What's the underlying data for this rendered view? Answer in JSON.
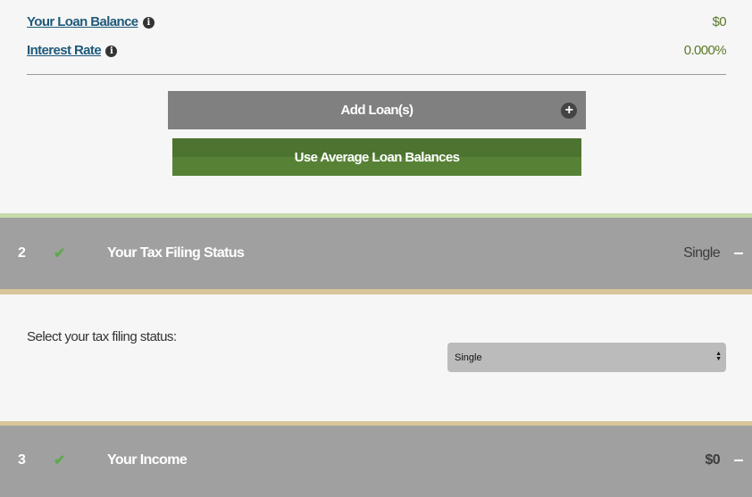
{
  "loan": {
    "balance_label": "Your Loan Balance",
    "balance_value": "$0",
    "rate_label": "Interest Rate",
    "rate_value": "0.000%",
    "add_label": "Add Loan(s)",
    "avg_label": "Use Average Loan Balances"
  },
  "sections": [
    {
      "number": "2",
      "title": "Your Tax Filing Status",
      "summary": "Single",
      "toggle": "–",
      "prompt": "Select your tax filing status:",
      "selected": "Single"
    },
    {
      "number": "3",
      "title": "Your Income",
      "summary": "$0",
      "toggle": "–"
    }
  ],
  "icons": {
    "info": "i",
    "plus": "+",
    "check": "✔",
    "select": "▲▼"
  },
  "colors": {
    "link": "#1f5a7a",
    "value": "#5a7a2a",
    "header": "#a0a0a0",
    "green_button": "#4c7330",
    "check": "#5daa50"
  }
}
